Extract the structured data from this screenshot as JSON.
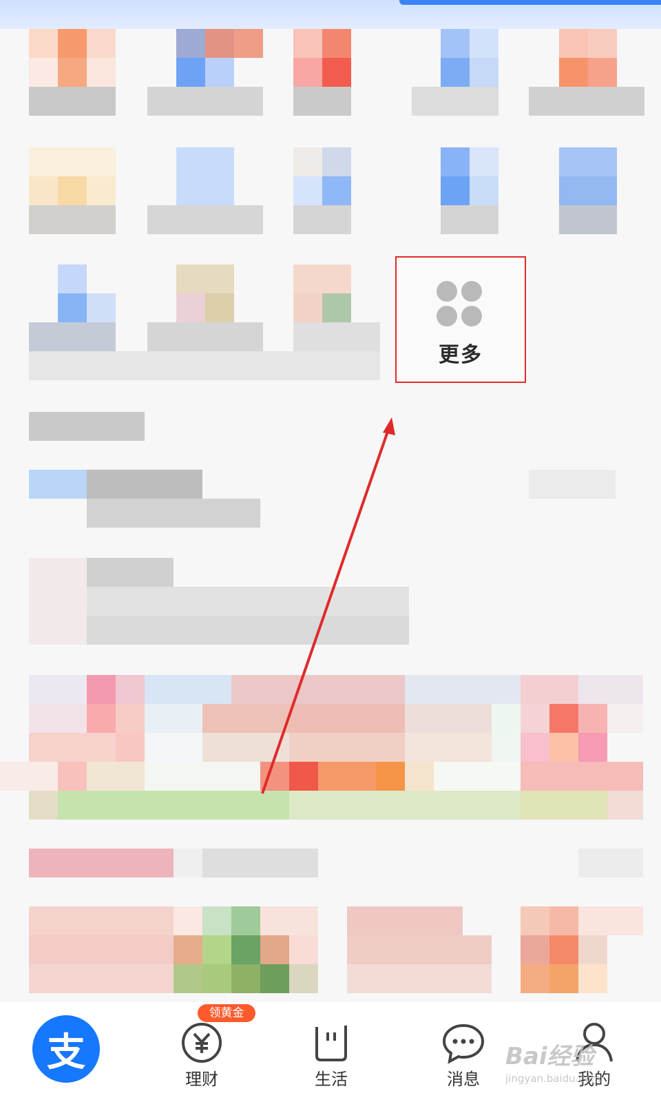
{
  "more_button": {
    "label": "更多",
    "icon": "four-dots-grid-icon"
  },
  "promo_badge": "领黄金",
  "tabbar": {
    "items": [
      {
        "label": "",
        "icon": "alipay-logo-icon"
      },
      {
        "label": "理财",
        "icon": "yuan-coin-icon"
      },
      {
        "label": "生活",
        "icon": "life-card-icon"
      },
      {
        "label": "消息",
        "icon": "chat-bubble-icon"
      },
      {
        "label": "我的",
        "icon": "person-icon"
      }
    ],
    "home_logo_text": "支"
  },
  "watermark": {
    "line1": "Bai经验",
    "line2": "jingyan.baidu.com"
  },
  "colors": {
    "annotation_red": "#e02a2a",
    "alipay_blue": "#1677ff",
    "badge_orange": "#ff5a2c"
  }
}
